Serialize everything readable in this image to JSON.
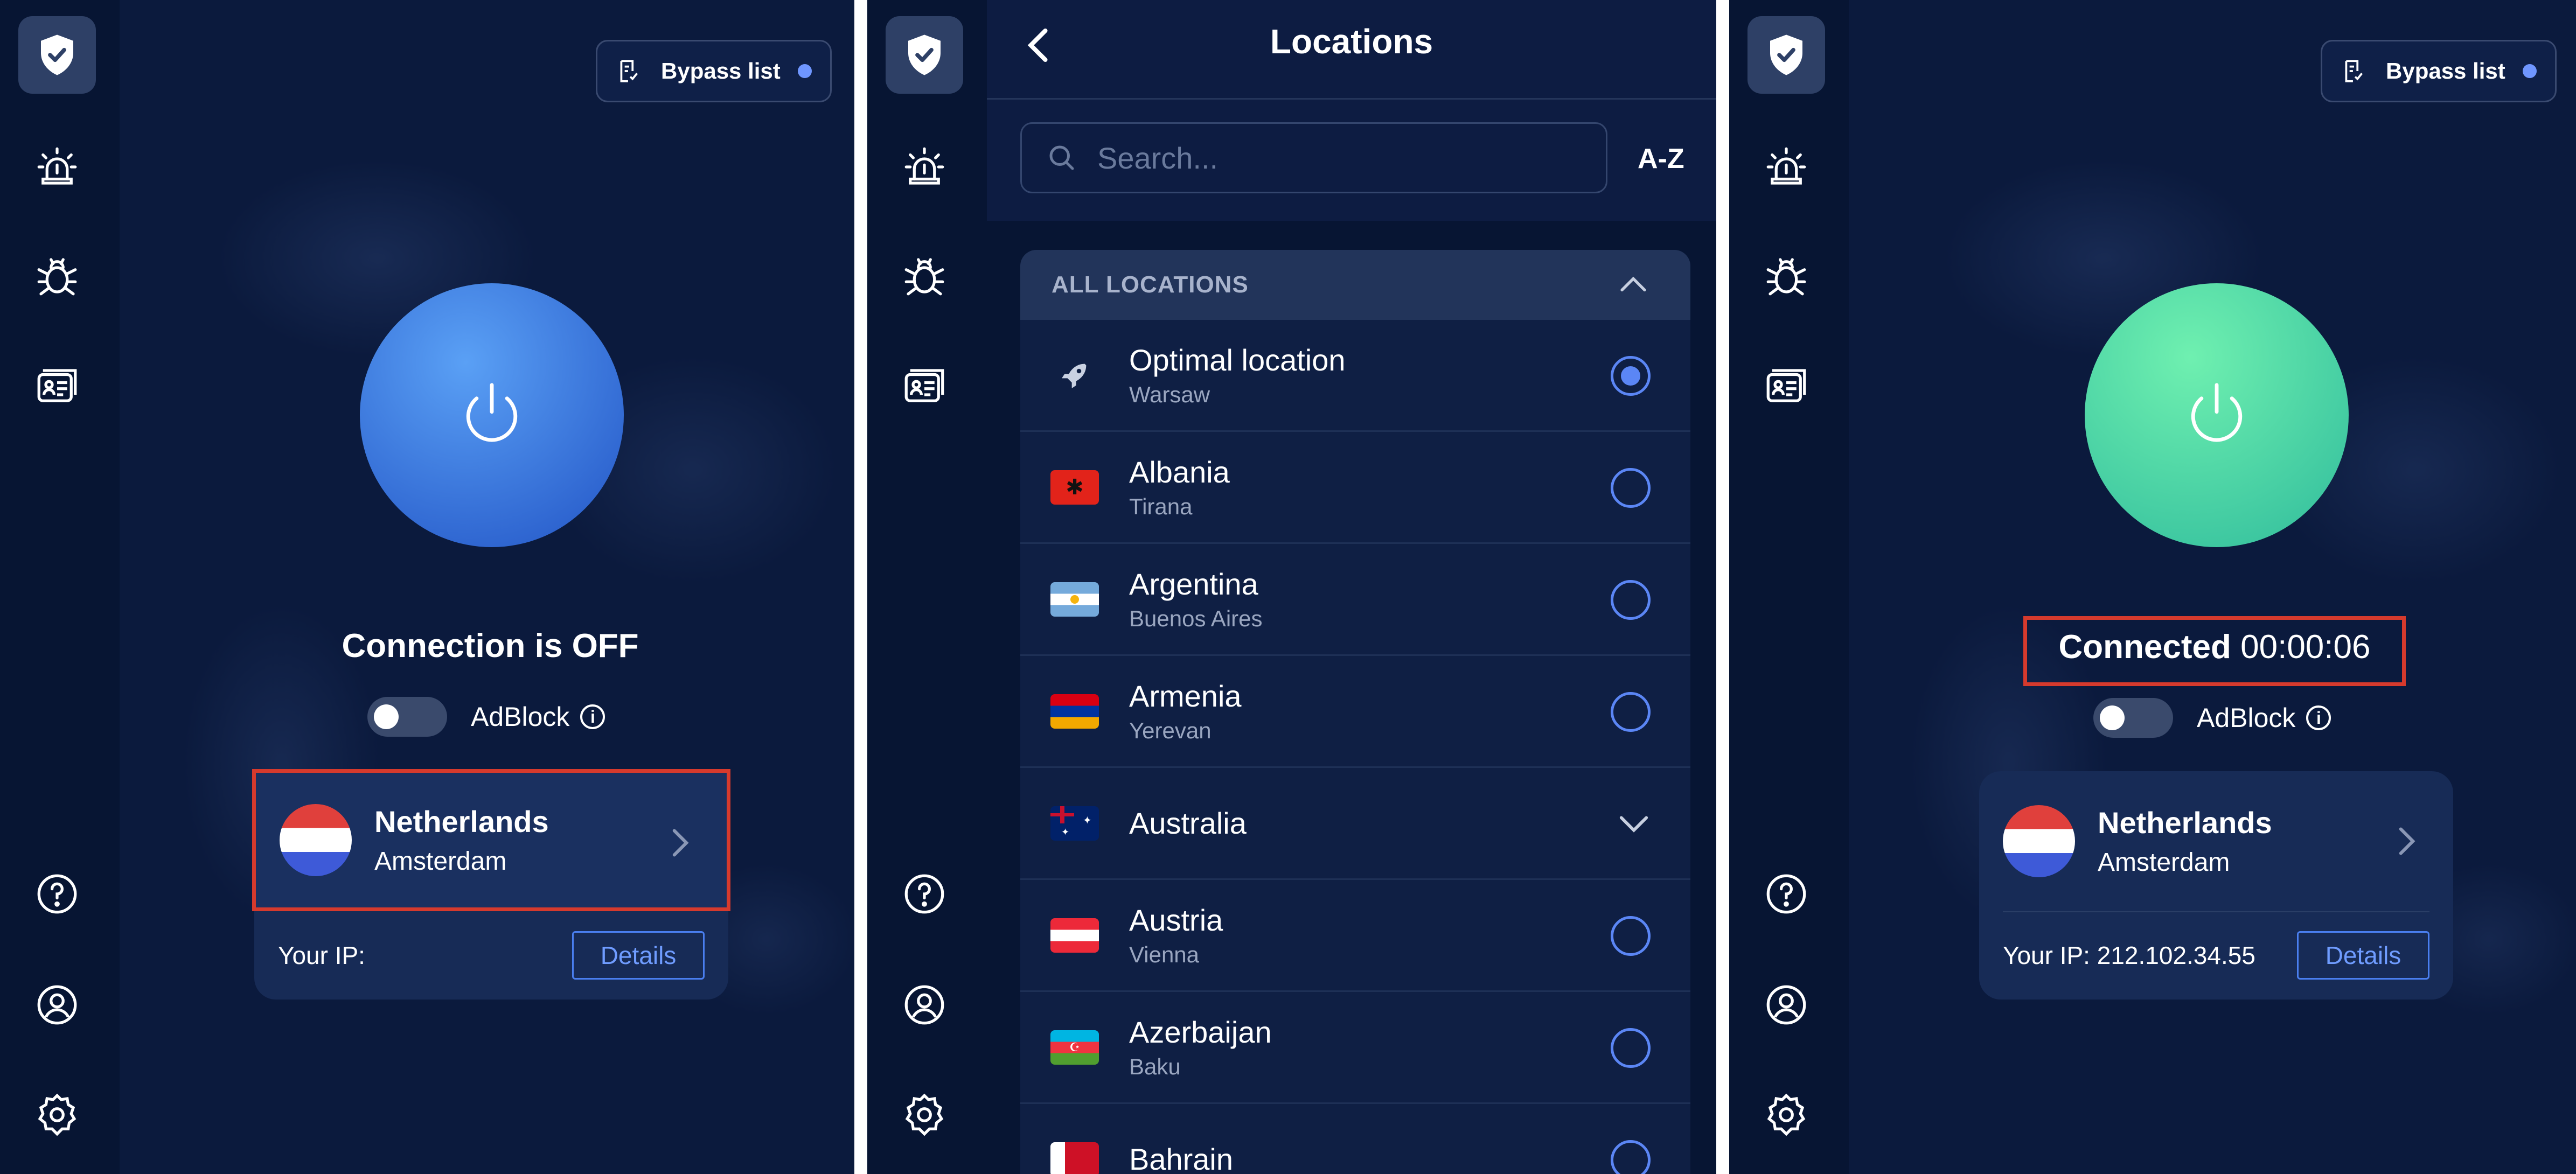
{
  "panels": {
    "disconnected": {
      "bypass_label": "Bypass list",
      "status_bold": "Connection is OFF",
      "status_extra": "",
      "adblock_label": "AdBlock",
      "country": "Netherlands",
      "city": "Amsterdam",
      "ip_label": "Your IP:",
      "details_label": "Details"
    },
    "connected": {
      "bypass_label": "Bypass list",
      "status_bold": "Connected",
      "status_extra": "00:00:06",
      "adblock_label": "AdBlock",
      "country": "Netherlands",
      "city": "Amsterdam",
      "ip_label": "Your IP: 212.102.34.55",
      "details_label": "Details"
    }
  },
  "locations": {
    "title": "Locations",
    "search_placeholder": "Search...",
    "sort_label": "A-Z",
    "section_label": "ALL LOCATIONS",
    "items": [
      {
        "country": "Optimal location",
        "city": "Warsaw",
        "icon": "rocket-icon",
        "selected": true
      },
      {
        "country": "Albania",
        "city": "Tirana",
        "icon": "flag-albania-icon",
        "selected": false
      },
      {
        "country": "Argentina",
        "city": "Buenos Aires",
        "icon": "flag-argentina-icon",
        "selected": false
      },
      {
        "country": "Armenia",
        "city": "Yerevan",
        "icon": "flag-armenia-icon",
        "selected": false
      },
      {
        "country": "Australia",
        "city": "",
        "icon": "flag-australia-icon",
        "expandable": true
      },
      {
        "country": "Austria",
        "city": "Vienna",
        "icon": "flag-austria-icon",
        "selected": false
      },
      {
        "country": "Azerbaijan",
        "city": "Baku",
        "icon": "flag-azerbaijan-icon",
        "selected": false
      },
      {
        "country": "Bahrain",
        "city": "",
        "icon": "flag-bahrain-icon",
        "selected": false
      }
    ]
  },
  "colors": {
    "background": "#0b1a3d",
    "rail": "#071533",
    "accent_blue": "#5b86f5",
    "power_off": "#3a7ae0",
    "power_on": "#4fd8a8",
    "highlight_red": "#d63a2d"
  },
  "icons": {
    "rail": [
      "shield-check-icon",
      "alarm-icon",
      "bug-icon",
      "id-card-icon",
      "help-icon",
      "account-icon",
      "settings-icon"
    ]
  }
}
